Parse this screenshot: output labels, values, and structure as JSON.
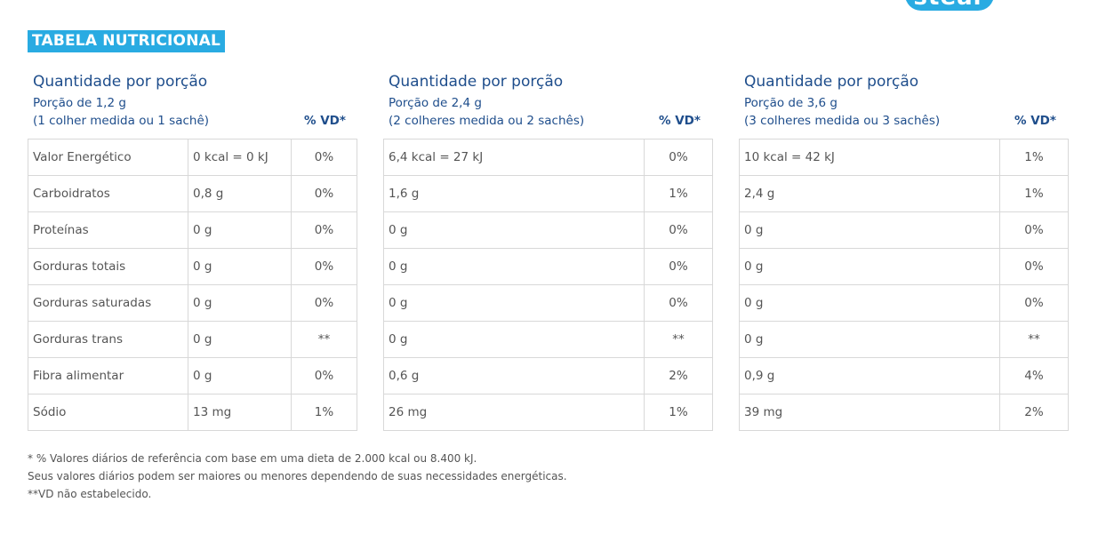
{
  "logo": {
    "text": "stear",
    "color": "#29abe2"
  },
  "heading": "TABELA NUTRICIONAL",
  "colors": {
    "accent": "#29abe2",
    "title_blue": "#1f4e8c"
  },
  "panels": [
    {
      "title": "Quantidade por porção",
      "portion": "Porção de 1,2 g",
      "measure": "(1 colher medida ou 1 sachê)",
      "vd_header": "% VD*",
      "rows": [
        {
          "name": "Valor Energético",
          "amount": "0 kcal = 0 kJ",
          "vd": "0%"
        },
        {
          "name": "Carboidratos",
          "amount": "0,8 g",
          "vd": "0%"
        },
        {
          "name": "Proteínas",
          "amount": "0 g",
          "vd": "0%"
        },
        {
          "name": "Gorduras totais",
          "amount": "0 g",
          "vd": "0%"
        },
        {
          "name": "Gorduras saturadas",
          "amount": "0 g",
          "vd": "0%"
        },
        {
          "name": "Gorduras trans",
          "amount": "0 g",
          "vd": "**"
        },
        {
          "name": "Fibra alimentar",
          "amount": "0 g",
          "vd": "0%"
        },
        {
          "name": "Sódio",
          "amount": "13 mg",
          "vd": "1%"
        }
      ]
    },
    {
      "title": "Quantidade por porção",
      "portion": "Porção de 2,4 g",
      "measure": "(2 colheres medida ou 2 sachês)",
      "vd_header": "% VD*",
      "rows": [
        {
          "amount": "6,4 kcal = 27 kJ",
          "vd": "0%"
        },
        {
          "amount": "1,6 g",
          "vd": "1%"
        },
        {
          "amount": "0 g",
          "vd": "0%"
        },
        {
          "amount": "0 g",
          "vd": "0%"
        },
        {
          "amount": "0 g",
          "vd": "0%"
        },
        {
          "amount": "0 g",
          "vd": "**"
        },
        {
          "amount": "0,6 g",
          "vd": "2%"
        },
        {
          "amount": "26 mg",
          "vd": "1%"
        }
      ]
    },
    {
      "title": "Quantidade por porção",
      "portion": "Porção de 3,6 g",
      "measure": "(3 colheres medida ou 3 sachês)",
      "vd_header": "% VD*",
      "rows": [
        {
          "amount": "10 kcal = 42 kJ",
          "vd": "1%"
        },
        {
          "amount": "2,4 g",
          "vd": "1%"
        },
        {
          "amount": "0 g",
          "vd": "0%"
        },
        {
          "amount": "0 g",
          "vd": "0%"
        },
        {
          "amount": "0 g",
          "vd": "0%"
        },
        {
          "amount": "0 g",
          "vd": "**"
        },
        {
          "amount": "0,9 g",
          "vd": "4%"
        },
        {
          "amount": "39 mg",
          "vd": "2%"
        }
      ]
    }
  ],
  "footnotes": [
    "* % Valores diários de referência com base em uma dieta de 2.000 kcal ou 8.400 kJ.",
    "Seus valores diários podem ser maiores ou menores dependendo de suas necessidades energéticas.",
    "**VD não estabelecido."
  ]
}
